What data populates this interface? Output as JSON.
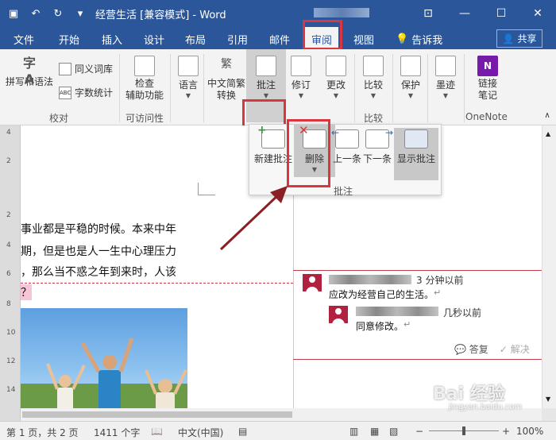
{
  "title_bar": {
    "title": "经营生活 [兼容模式] - Word",
    "quick_access": [
      "save-icon",
      "undo-icon",
      "redo-icon",
      "customize-icon"
    ],
    "window_buttons": [
      "ribbon-display-icon",
      "minimize-icon",
      "maximize-icon",
      "close-icon"
    ]
  },
  "tabs": [
    "文件",
    "开始",
    "插入",
    "设计",
    "布局",
    "引用",
    "邮件",
    "审阅",
    "视图"
  ],
  "active_tab": "审阅",
  "tell_me": "告诉我",
  "share": "共享",
  "ribbon": {
    "proofing": {
      "spell": "拼写和语法",
      "thesaurus": "同义词库",
      "wordcount": "字数统计",
      "label": "校对"
    },
    "accessibility": {
      "check": "检查\n辅助功能",
      "label": "可访问性"
    },
    "language": {
      "label_btn": "语言"
    },
    "chinese": {
      "convert": "中文简繁\n转换"
    },
    "comments": {
      "label_btn": "批注"
    },
    "tracking": {
      "label_btn": "修订"
    },
    "changes": {
      "label_btn": "更改"
    },
    "compare": {
      "label_btn": "比较",
      "label": "比较"
    },
    "protect": {
      "label_btn": "保护"
    },
    "ink": {
      "label_btn": "墨迹"
    },
    "onenote": {
      "link": "链接\n笔记",
      "label": "OneNote"
    }
  },
  "comments_panel": {
    "new": "新建批注",
    "delete": "删除",
    "prev": "上一条",
    "next": "下一条",
    "show": "显示批注",
    "label": "批注"
  },
  "document": {
    "lines": [
      "事业都是平稳的时候。本来中年",
      "期，但是也是人一生中心理压力",
      "，那么当不惑之年到来时，人该",
      "？"
    ]
  },
  "comments": [
    {
      "time": "3 分钟以前",
      "text": "应改为经营自己的生活。"
    },
    {
      "time": "几秒以前",
      "text": "同意修改。"
    }
  ],
  "comment_actions": {
    "reply": "答复",
    "resolve": "解决"
  },
  "status": {
    "page": "第 1 页，共 2 页",
    "words": "1411 个字",
    "language": "中文(中国)",
    "zoom": "100%"
  },
  "ruler_marks": [
    "4",
    "2",
    "2",
    "4",
    "6",
    "8",
    "10",
    "12",
    "14"
  ],
  "watermark": "Bai 经验",
  "watermark_sub": "jingyan.baidu.com"
}
